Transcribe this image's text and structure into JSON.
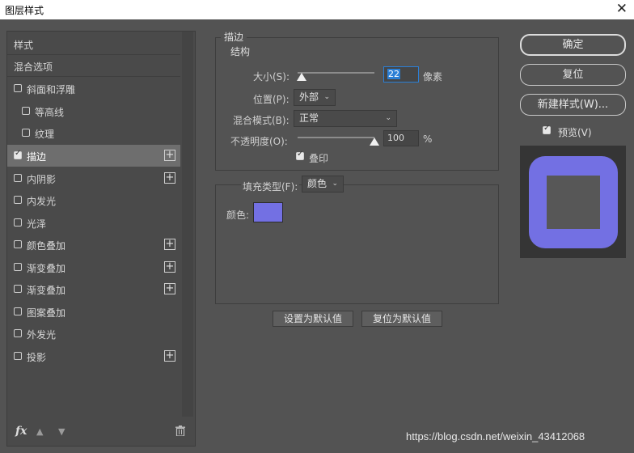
{
  "window": {
    "title": "图层样式",
    "close_glyph": "✕"
  },
  "sidebar": {
    "items": [
      {
        "label": "样式",
        "type": "header"
      },
      {
        "label": "混合选项",
        "type": "header"
      },
      {
        "label": "斜面和浮雕",
        "checked": false,
        "plus": false,
        "indent": false
      },
      {
        "label": "等高线",
        "checked": false,
        "plus": false,
        "indent": true
      },
      {
        "label": "纹理",
        "checked": false,
        "plus": false,
        "indent": true
      },
      {
        "label": "描边",
        "checked": true,
        "plus": true,
        "indent": false,
        "active": true
      },
      {
        "label": "内阴影",
        "checked": false,
        "plus": true,
        "indent": false
      },
      {
        "label": "内发光",
        "checked": false,
        "plus": false,
        "indent": false
      },
      {
        "label": "光泽",
        "checked": false,
        "plus": false,
        "indent": false
      },
      {
        "label": "颜色叠加",
        "checked": false,
        "plus": true,
        "indent": false
      },
      {
        "label": "渐变叠加",
        "checked": false,
        "plus": true,
        "indent": false
      },
      {
        "label": "渐变叠加",
        "checked": false,
        "plus": true,
        "indent": false
      },
      {
        "label": "图案叠加",
        "checked": false,
        "plus": false,
        "indent": false
      },
      {
        "label": "外发光",
        "checked": false,
        "plus": false,
        "indent": false
      },
      {
        "label": "投影",
        "checked": false,
        "plus": true,
        "indent": false
      }
    ],
    "bottom": {
      "fx": "fx",
      "up": "▲",
      "down": "▼",
      "trash_icon": "trash-icon"
    }
  },
  "stroke": {
    "group_title": "描边",
    "structure": {
      "title": "结构",
      "size_label": "大小(S):",
      "size_value": "22",
      "size_unit": "像素",
      "size_level": 0.05,
      "position_label": "位置(P):",
      "position_value": "外部",
      "blend_label": "混合模式(B):",
      "blend_value": "正常",
      "opacity_label": "不透明度(O):",
      "opacity_value": "100",
      "opacity_unit": "%",
      "opacity_level": 1.0,
      "overprint_label": "叠印",
      "overprint_checked": true
    },
    "fill": {
      "type_label": "填充类型(F):",
      "type_value": "颜色",
      "color_label": "颜色:",
      "color": "#7370e3"
    },
    "buttons": {
      "set_default": "设置为默认值",
      "reset_default": "复位为默认值"
    }
  },
  "actions": {
    "ok": "确定",
    "reset": "复位",
    "new_style": "新建样式(W)...",
    "preview_label": "预览(V)",
    "preview_checked": true
  },
  "watermark": "https://blog.csdn.net/weixin_43412068",
  "colors": {
    "background": "#535353",
    "accent": "#7370e3",
    "focus": "#2b7fd6"
  }
}
